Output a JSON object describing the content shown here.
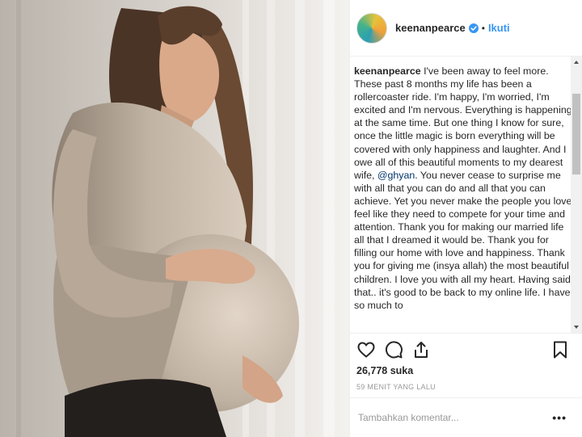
{
  "post": {
    "photo": {
      "alt_icon": "photo-pregnant-woman"
    },
    "header": {
      "username": "keenanpearce",
      "separator": "•",
      "follow_label": "Ikuti"
    },
    "caption": {
      "username": "keenanpearce",
      "text_part1": " I've been away to feel more. These past 8 months my life has been a rollercoaster ride. I'm happy, I'm worried, I'm excited and I'm nervous. Everything is happening at the same time. But one thing I know for sure, once the little magic is born everything will be covered with only happiness and laughter. And I owe all of this beautiful moments to my dearest wife, ",
      "mention": "@ghyan",
      "text_part2": ". You never cease to surprise me with all that you can do and all that you can achieve. Yet you never make the people you love feel like they need to compete for your time and attention. Thank you for making our married life all that I dreamed it would be. Thank you for filling our home with love and happiness. Thank you for giving me (insya allah) the most beautiful children. I love you with all my heart. Having said that.. it's good to be back to my online life. I have so much to"
    },
    "likes": "26,778 suka",
    "time": "59 MENIT YANG LALU",
    "comment": {
      "placeholder": "Tambahkan komentar...",
      "more_label": "•••"
    },
    "colors": {
      "link": "#3897f0",
      "text": "#262626",
      "muted": "#999999",
      "verified": "#3897f0"
    }
  }
}
